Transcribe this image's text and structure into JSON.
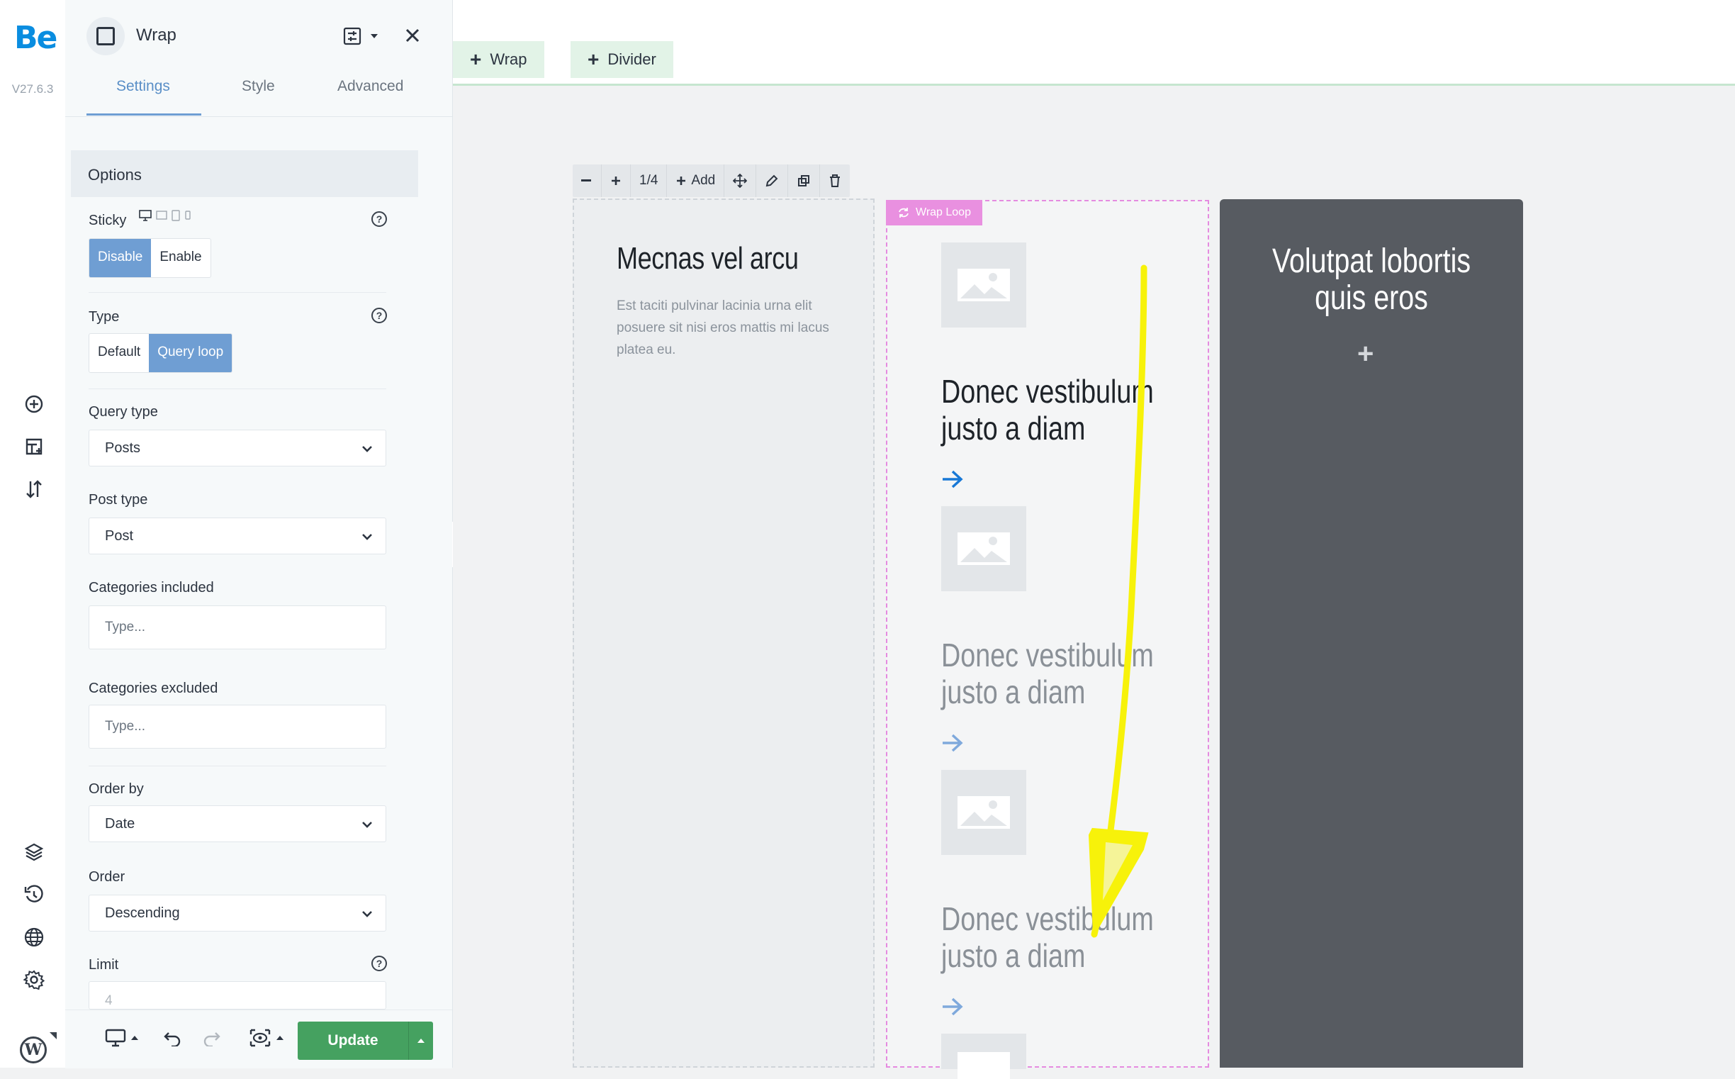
{
  "app": {
    "logo": "Be",
    "version": "V27.6.3"
  },
  "rail": {
    "icons": [
      "add-element-icon",
      "add-template-icon",
      "sort-icon",
      "layers-icon",
      "history-icon",
      "globe-icon",
      "settings-icon",
      "wordpress-icon"
    ]
  },
  "panel": {
    "title": "Wrap",
    "tabs": [
      {
        "label": "Settings",
        "active": true
      },
      {
        "label": "Style",
        "active": false
      },
      {
        "label": "Advanced",
        "active": false
      }
    ],
    "section": "Options",
    "sticky": {
      "label": "Sticky",
      "options": [
        "Disable",
        "Enable"
      ],
      "selected": "Disable"
    },
    "type": {
      "label": "Type",
      "options": [
        "Default",
        "Query loop"
      ],
      "selected": "Query loop"
    },
    "query_type": {
      "label": "Query type",
      "value": "Posts"
    },
    "post_type": {
      "label": "Post type",
      "value": "Post"
    },
    "categories_included": {
      "label": "Categories included",
      "placeholder": "Type..."
    },
    "categories_excluded": {
      "label": "Categories excluded",
      "placeholder": "Type..."
    },
    "order_by": {
      "label": "Order by",
      "value": "Date"
    },
    "order": {
      "label": "Order",
      "value": "Descending"
    },
    "limit": {
      "label": "Limit",
      "placeholder": "4"
    },
    "update_label": "Update"
  },
  "canvas": {
    "add_buttons": [
      "Wrap",
      "Divider"
    ],
    "toolbar": {
      "fraction": "1/4",
      "add_label": "Add"
    },
    "loop_badge": "Wrap Loop",
    "col1": {
      "title": "Mecnas vel arcu",
      "text": "Est taciti pulvinar lacinia urna elit posuere sit nisi eros mattis mi lacus platea eu."
    },
    "posts": [
      {
        "title_line1": "Donec vestibulum",
        "title_line2": "justo a diam"
      },
      {
        "title_line1": "Donec vestibulum",
        "title_line2": "justo a diam"
      },
      {
        "title_line1": "Donec vestibulum",
        "title_line2": "justo a diam"
      }
    ],
    "col3": {
      "title_line1": "Volutpat lobortis",
      "title_line2": "quis eros"
    }
  },
  "colors": {
    "accent": "#6f9ed3",
    "update": "#45a160",
    "loop": "#e990e0",
    "annotation": "#f7f20a"
  }
}
